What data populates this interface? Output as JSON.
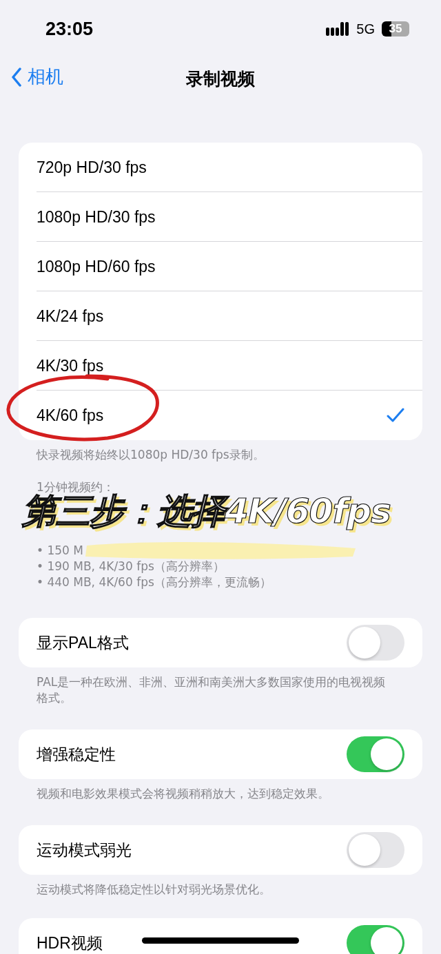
{
  "status_bar": {
    "time": "23:05",
    "network": "5G",
    "battery": "35"
  },
  "nav": {
    "back": "相机",
    "title": "录制视频"
  },
  "formats": [
    {
      "label": "720p HD/30 fps",
      "selected": false
    },
    {
      "label": "1080p HD/30 fps",
      "selected": false
    },
    {
      "label": "1080p HD/60 fps",
      "selected": false
    },
    {
      "label": "4K/24 fps",
      "selected": false
    },
    {
      "label": "4K/30 fps",
      "selected": false
    },
    {
      "label": "4K/60 fps",
      "selected": true
    }
  ],
  "format_note": "快录视频将始终以1080p HD/30 fps录制。",
  "size_heading": "1分钟视频约：",
  "size_lines": [
    "• 150 M",
    "• 190 MB, 4K/30 fps（高分辨率）",
    "• 440 MB, 4K/60 fps（高分辨率，更流畅）"
  ],
  "caption": "第三步：选择4K/60fps",
  "toggles": [
    {
      "label": "显示PAL格式",
      "on": false,
      "note": "PAL是一种在欧洲、非洲、亚洲和南美洲大多数国家使用的电视视频格式。"
    },
    {
      "label": "增强稳定性",
      "on": true,
      "note": "视频和电影效果模式会将视频稍稍放大，达到稳定效果。"
    },
    {
      "label": "运动模式弱光",
      "on": false,
      "note": "运动模式将降低稳定性以针对弱光场景优化。"
    },
    {
      "label": "HDR视频",
      "on": true
    }
  ]
}
